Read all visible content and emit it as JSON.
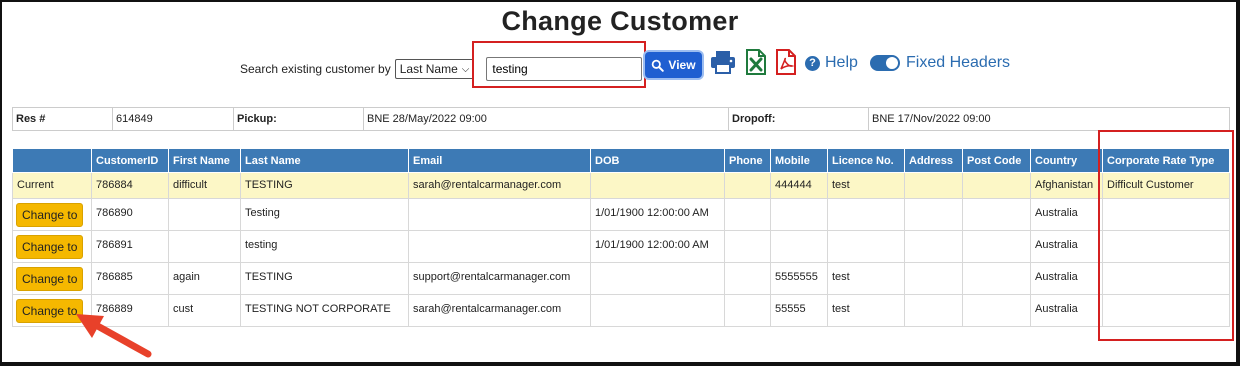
{
  "title": "Change Customer",
  "search": {
    "label": "Search existing customer by",
    "by_value": "Last Name",
    "query": "testing",
    "view_label": "View"
  },
  "toolbar": {
    "help_label": "Help",
    "fixed_headers_label": "Fixed Headers",
    "fixed_headers_on": true
  },
  "reservation": {
    "res_label": "Res #",
    "res_value": "614849",
    "pickup_label": "Pickup:",
    "pickup_value": "BNE 28/May/2022 09:00",
    "dropoff_label": "Dropoff:",
    "dropoff_value": "BNE 17/Nov/2022 09:00"
  },
  "table": {
    "headers": [
      "",
      "CustomerID",
      "First Name",
      "Last Name",
      "Email",
      "DOB",
      "Phone",
      "Mobile",
      "Licence No.",
      "Address",
      "Post Code",
      "Country",
      "Corporate Rate Type"
    ],
    "action_label": "Change to",
    "current_label": "Current",
    "rows": [
      {
        "action": "Current",
        "id": "786884",
        "first": "difficult",
        "last": "TESTING",
        "email": "sarah@rentalcarmanager.com",
        "dob": "",
        "phone": "",
        "mobile": "444444",
        "licence": "test",
        "address": "",
        "postcode": "",
        "country": "Afghanistan",
        "corp": "Difficult Customer"
      },
      {
        "action": "Change to",
        "id": "786890",
        "first": "",
        "last": "Testing",
        "email": "",
        "dob": "1/01/1900 12:00:00 AM",
        "phone": "",
        "mobile": "",
        "licence": "",
        "address": "",
        "postcode": "",
        "country": "Australia",
        "corp": ""
      },
      {
        "action": "Change to",
        "id": "786891",
        "first": "",
        "last": "testing",
        "email": "",
        "dob": "1/01/1900 12:00:00 AM",
        "phone": "",
        "mobile": "",
        "licence": "",
        "address": "",
        "postcode": "",
        "country": "Australia",
        "corp": ""
      },
      {
        "action": "Change to",
        "id": "786885",
        "first": "again",
        "last": "TESTING",
        "email": "support@rentalcarmanager.com",
        "dob": "",
        "phone": "",
        "mobile": "5555555",
        "licence": "test",
        "address": "",
        "postcode": "",
        "country": "Australia",
        "corp": ""
      },
      {
        "action": "Change to",
        "id": "786889",
        "first": "cust",
        "last": "TESTING NOT CORPORATE",
        "email": "sarah@rentalcarmanager.com",
        "dob": "",
        "phone": "",
        "mobile": "55555",
        "licence": "test",
        "address": "",
        "postcode": "",
        "country": "Australia",
        "corp": ""
      }
    ]
  },
  "colors": {
    "header_bg": "#3d7ab5",
    "current_row_bg": "#fcf7c6",
    "button_bg": "#f5b800",
    "view_bg": "#1f5fd1",
    "highlight": "#d42020",
    "annotation_arrow": "#e8412a"
  },
  "icons": [
    "search-icon",
    "printer-icon",
    "excel-icon",
    "pdf-icon",
    "help-icon",
    "toggle-icon",
    "annotation-arrow"
  ]
}
